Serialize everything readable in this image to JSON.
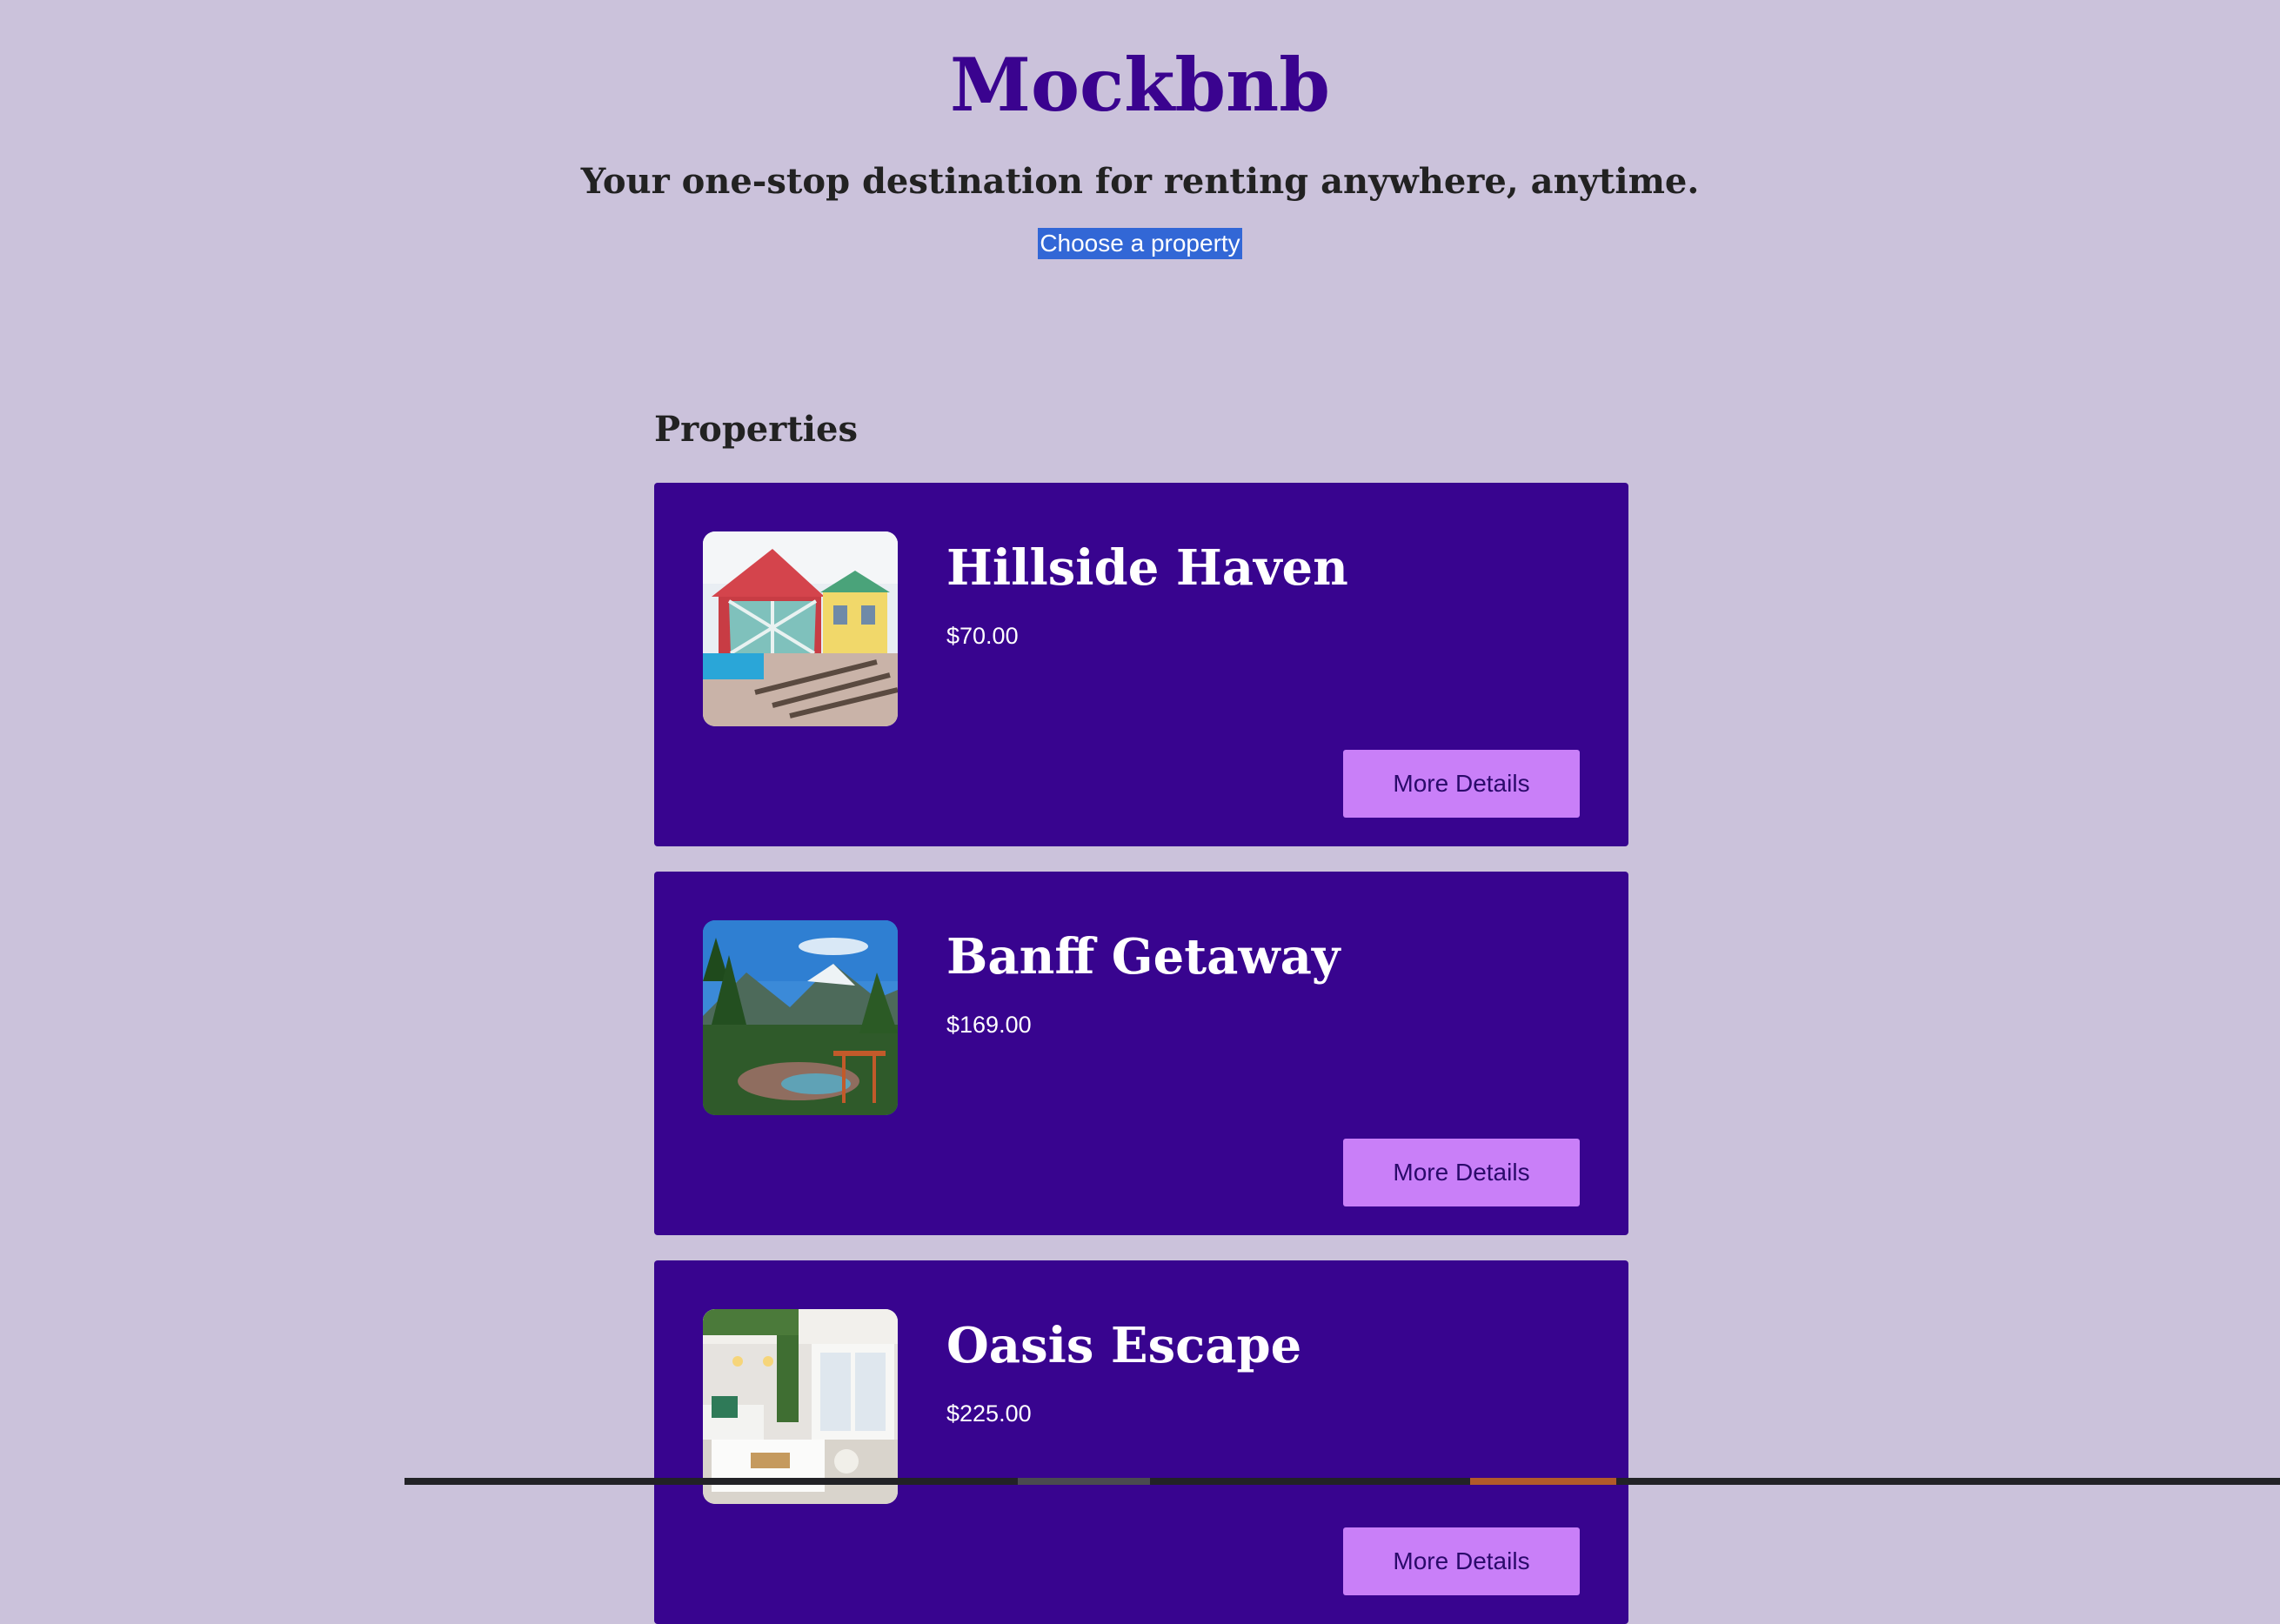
{
  "header": {
    "title": "Mockbnb",
    "tagline": "Your one-stop destination for renting anywhere, anytime.",
    "choose_link": "Choose a property"
  },
  "properties": {
    "heading": "Properties",
    "items": [
      {
        "name": "Hillside Haven",
        "price": "$70.00",
        "button": "More Details"
      },
      {
        "name": "Banff Getaway",
        "price": "$169.00",
        "button": "More Details"
      },
      {
        "name": "Oasis Escape",
        "price": "$225.00",
        "button": "More Details"
      }
    ]
  },
  "colors": {
    "background": "#cbc2db",
    "brand": "#3a038f",
    "card": "#38048f",
    "button": "#c97ff8",
    "selection": "#3267d6"
  }
}
